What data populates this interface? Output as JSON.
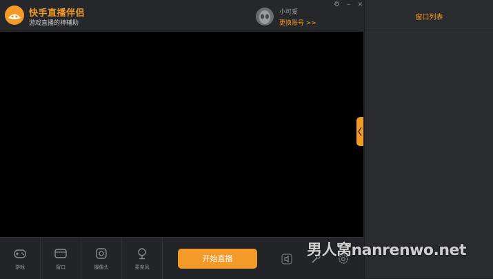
{
  "app": {
    "title": "快手直播伴侣",
    "subtitle": "游戏直播的神辅助"
  },
  "user": {
    "name": "小可爱",
    "switch_label": "更换账号 >>"
  },
  "window_controls": {
    "settings": "⚙",
    "minimize": "–",
    "close": "×"
  },
  "right_panel": {
    "title": "窗口列表"
  },
  "tools": [
    {
      "label": "游戏",
      "icon": "gamepad-icon"
    },
    {
      "label": "窗口",
      "icon": "window-icon"
    },
    {
      "label": "摄像头",
      "icon": "camera-icon"
    },
    {
      "label": "麦克风",
      "icon": "microphone-icon"
    }
  ],
  "start_button": {
    "label": "开始直播"
  },
  "right_tools": [
    {
      "icon": "speaker-icon"
    },
    {
      "icon": "tools-icon"
    },
    {
      "icon": "settings-icon"
    }
  ],
  "watermark": "男人窝nanrenwo.net",
  "colors": {
    "accent": "#f29a25",
    "preview": "#000000",
    "panel": "#2a2b2f"
  }
}
